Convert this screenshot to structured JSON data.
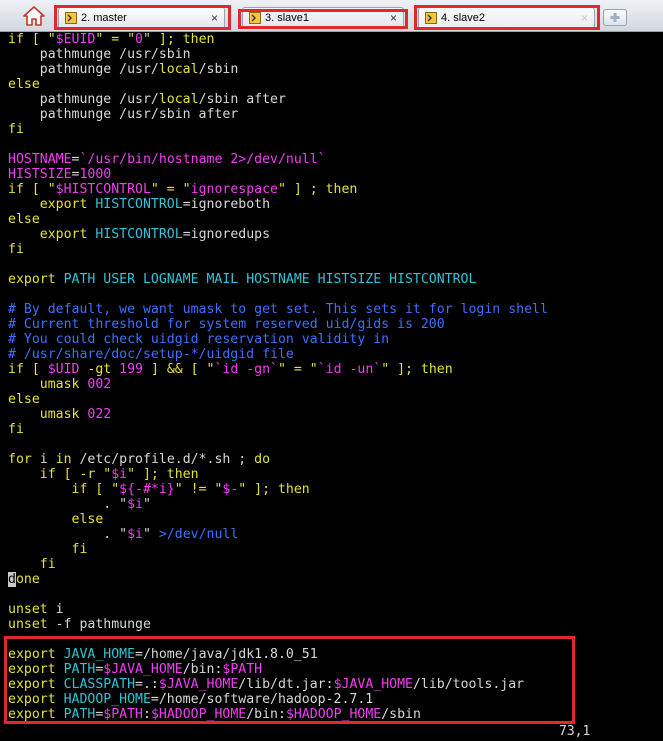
{
  "tabs": [
    {
      "label": "2. master",
      "close": "×"
    },
    {
      "label": "3. slave1",
      "close": "×"
    },
    {
      "label": "4. slave2",
      "close": "×"
    }
  ],
  "code": [
    [
      [
        "k",
        "if [ \""
      ],
      [
        "s",
        "$EUID"
      ],
      [
        "k",
        "\" = \""
      ],
      [
        "n",
        "0"
      ],
      [
        "k",
        "\" ]; then"
      ]
    ],
    [
      [
        "w",
        "    pathmunge /usr/sbin"
      ]
    ],
    [
      [
        "w",
        "    pathmunge /usr/"
      ],
      [
        "k",
        "local"
      ],
      [
        "w",
        "/sbin"
      ]
    ],
    [
      [
        "k",
        "else"
      ]
    ],
    [
      [
        "w",
        "    pathmunge /usr/"
      ],
      [
        "k",
        "local"
      ],
      [
        "w",
        "/sbin after"
      ]
    ],
    [
      [
        "w",
        "    pathmunge /usr/sbin after"
      ]
    ],
    [
      [
        "k",
        "fi"
      ]
    ],
    [],
    [
      [
        "v",
        "HOSTNAME"
      ],
      [
        "w",
        "="
      ],
      [
        "s",
        "`/usr/bin/hostname 2>/dev/null`"
      ]
    ],
    [
      [
        "v",
        "HISTSIZE"
      ],
      [
        "w",
        "="
      ],
      [
        "n",
        "1000"
      ]
    ],
    [
      [
        "k",
        "if [ \""
      ],
      [
        "s",
        "$HISTCONTROL"
      ],
      [
        "k",
        "\" = \""
      ],
      [
        "n",
        "ignorespace"
      ],
      [
        "k",
        "\" ] ; then"
      ]
    ],
    [
      [
        "k",
        "    export "
      ],
      [
        "cy",
        "HISTCONTROL"
      ],
      [
        "w",
        "=ignoreboth"
      ]
    ],
    [
      [
        "k",
        "else"
      ]
    ],
    [
      [
        "k",
        "    export "
      ],
      [
        "cy",
        "HISTCONTROL"
      ],
      [
        "w",
        "=ignoredups"
      ]
    ],
    [
      [
        "k",
        "fi"
      ]
    ],
    [],
    [
      [
        "k",
        "export "
      ],
      [
        "cy",
        "PATH USER LOGNAME MAIL HOSTNAME HISTSIZE HISTCONTROL"
      ]
    ],
    [],
    [
      [
        "c",
        "# By default, we want umask to get set. This sets it for login shell"
      ]
    ],
    [
      [
        "c",
        "# Current threshold for system reserved uid/gids is 200"
      ]
    ],
    [
      [
        "c",
        "# You could check uidgid reservation validity in"
      ]
    ],
    [
      [
        "c",
        "# /usr/share/doc/setup-*/uidgid file"
      ]
    ],
    [
      [
        "k",
        "if [ "
      ],
      [
        "s",
        "$UID"
      ],
      [
        "k",
        " -gt "
      ],
      [
        "n",
        "199"
      ],
      [
        "k",
        " ] && [ \""
      ],
      [
        "s",
        "`id -gn`"
      ],
      [
        "k",
        "\" = \""
      ],
      [
        "s",
        "`id -un`"
      ],
      [
        "k",
        "\" ]; then"
      ]
    ],
    [
      [
        "k",
        "    umask "
      ],
      [
        "n",
        "002"
      ]
    ],
    [
      [
        "k",
        "else"
      ]
    ],
    [
      [
        "k",
        "    umask "
      ],
      [
        "n",
        "022"
      ]
    ],
    [
      [
        "k",
        "fi"
      ]
    ],
    [],
    [
      [
        "k",
        "for "
      ],
      [
        "w",
        "i "
      ],
      [
        "k",
        "in "
      ],
      [
        "w",
        "/etc/profile.d/*.sh ; "
      ],
      [
        "k",
        "do"
      ]
    ],
    [
      [
        "k",
        "    if [ -r \""
      ],
      [
        "s",
        "$i"
      ],
      [
        "k",
        "\" ]; then"
      ]
    ],
    [
      [
        "k",
        "        if [ \""
      ],
      [
        "s",
        "${-#*i}"
      ],
      [
        "k",
        "\" != \""
      ],
      [
        "s",
        "$-"
      ],
      [
        "k",
        "\" ]; then"
      ]
    ],
    [
      [
        "w",
        "            . \""
      ],
      [
        "s",
        "$i"
      ],
      [
        "w",
        "\""
      ]
    ],
    [
      [
        "k",
        "        else"
      ]
    ],
    [
      [
        "w",
        "            . \""
      ],
      [
        "s",
        "$i"
      ],
      [
        "w",
        "\" "
      ],
      [
        "c",
        ">/dev/null"
      ]
    ],
    [
      [
        "k",
        "        fi"
      ]
    ],
    [
      [
        "k",
        "    fi"
      ]
    ],
    [
      [
        "cursor",
        "d"
      ],
      [
        "k",
        "one"
      ]
    ],
    [],
    [
      [
        "k",
        "unset "
      ],
      [
        "w",
        "i"
      ]
    ],
    [
      [
        "k",
        "unset "
      ],
      [
        "w",
        "-f pathmunge"
      ]
    ],
    [],
    [
      [
        "k",
        "export "
      ],
      [
        "cy",
        "JAVA_HOME"
      ],
      [
        "w",
        "=/home/java/jdk1.8.0_51"
      ]
    ],
    [
      [
        "k",
        "export "
      ],
      [
        "cy",
        "PATH"
      ],
      [
        "w",
        "="
      ],
      [
        "s",
        "$JAVA_HOME"
      ],
      [
        "w",
        "/bin:"
      ],
      [
        "s",
        "$PATH"
      ]
    ],
    [
      [
        "k",
        "export "
      ],
      [
        "cy",
        "CLASSPATH"
      ],
      [
        "w",
        "=.:"
      ],
      [
        "s",
        "$JAVA_HOME"
      ],
      [
        "w",
        "/lib/dt.jar:"
      ],
      [
        "s",
        "$JAVA_HOME"
      ],
      [
        "w",
        "/lib/tools.jar"
      ]
    ],
    [
      [
        "k",
        "export "
      ],
      [
        "cy",
        "HADOOP_HOME"
      ],
      [
        "w",
        "=/home/software/hadoop-2.7.1"
      ]
    ],
    [
      [
        "k",
        "export "
      ],
      [
        "cy",
        "PATH"
      ],
      [
        "w",
        "="
      ],
      [
        "s",
        "$PATH"
      ],
      [
        "w",
        ":"
      ],
      [
        "s",
        "$HADOOP_HOME"
      ],
      [
        "w",
        "/bin:"
      ],
      [
        "s",
        "$HADOOP_HOME"
      ],
      [
        "w",
        "/sbin"
      ]
    ]
  ],
  "status": {
    "position": "73,1"
  },
  "icons": {
    "home": "home-icon",
    "tab": "terminal-icon",
    "new_tab": "plus-icon"
  },
  "colors": {
    "keyword": "#e4e234",
    "variable": "#f33cf3",
    "comment": "#3f6fff",
    "export_name": "#2fc4d6",
    "highlight_box": "#e0292b"
  }
}
